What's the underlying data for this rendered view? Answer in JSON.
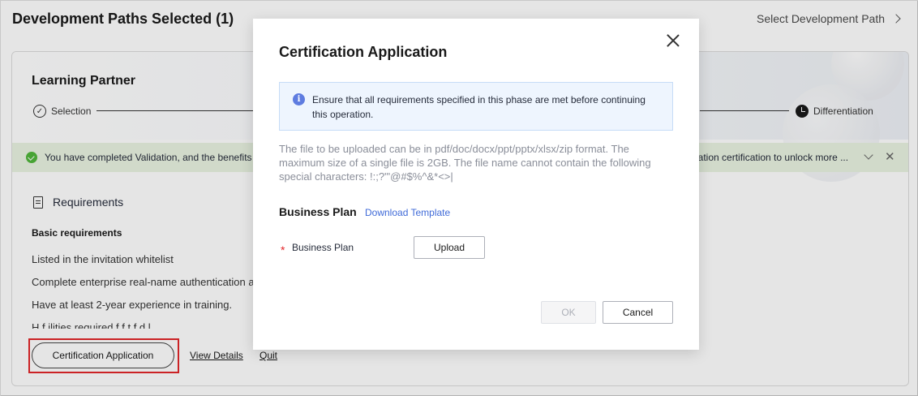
{
  "page": {
    "title": "Development Paths Selected (1)",
    "select_path_link": "Select Development Path"
  },
  "card": {
    "title": "Learning Partner",
    "steps": {
      "first": "Selection",
      "last": "Differentiation"
    },
    "banner": {
      "text_left": "You have completed Validation, and the benefits",
      "text_right": "iation certification to unlock more ..."
    },
    "requirements": {
      "heading": "Requirements",
      "basic_heading": "Basic requirements",
      "items": [
        "Listed in the invitation whitelist",
        "Complete enterprise real-name authentication a",
        "Have at least 2-year experience in training.",
        "H  f  ilities   required f  f       t  f      d  l"
      ]
    },
    "actions": {
      "certification": "Certification Application",
      "view_details": "View Details",
      "quit": "Quit"
    }
  },
  "modal": {
    "title": "Certification Application",
    "notice": "Ensure that all requirements specified in this phase are met before continuing this operation.",
    "hint": "The file to be uploaded can be in pdf/doc/docx/ppt/pptx/xlsx/zip format. The maximum size of a single file is 2GB. The file name cannot contain the following special characters: !:;?'\"@#$%^&*<>|",
    "section_title": "Business Plan",
    "download_template": "Download Template",
    "field_label": "Business Plan",
    "required_mark": "*",
    "upload_label": "Upload",
    "ok_label": "OK",
    "cancel_label": "Cancel"
  },
  "colors": {
    "highlight": "#e3262a",
    "success": "#50b63a",
    "info": "#5e7ce0",
    "link": "#3f6ad8"
  }
}
